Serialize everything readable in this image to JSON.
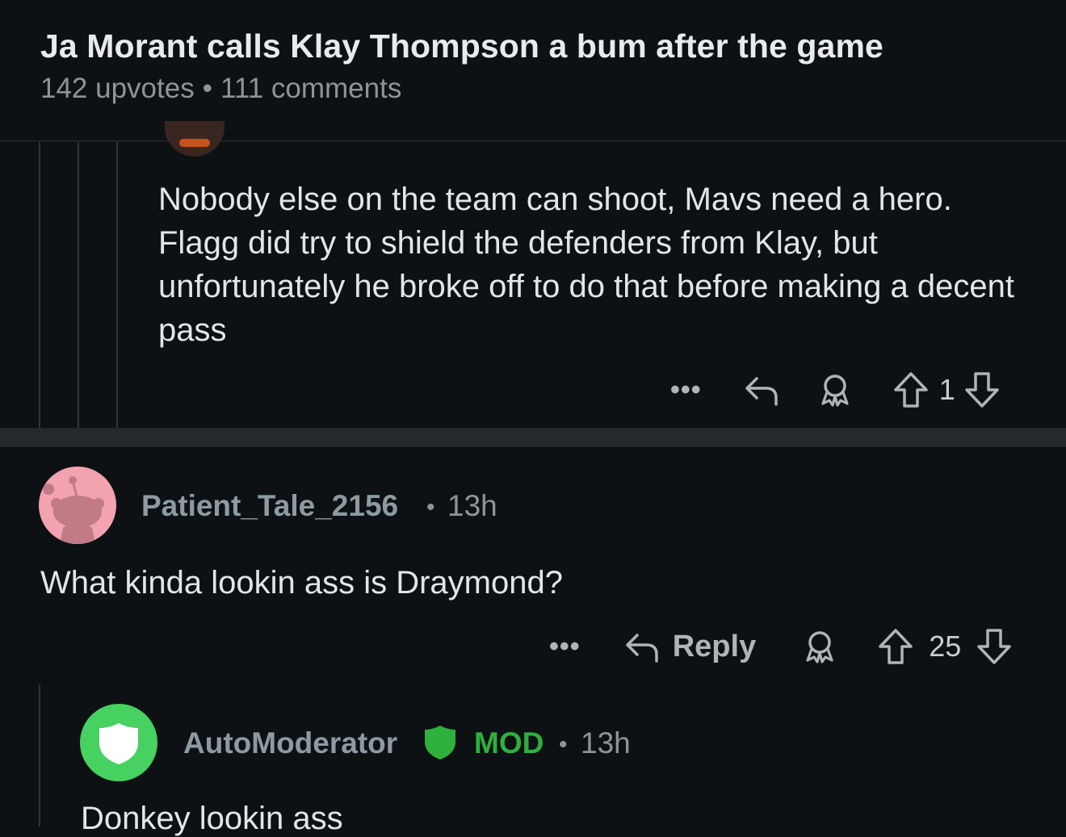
{
  "post": {
    "title": "Ja Morant calls Klay Thompson a bum after the game",
    "upvotes": "142 upvotes",
    "separator": "•",
    "comments": "111 comments"
  },
  "reply1": {
    "body": "Nobody else on the team can shoot, Mavs need a hero. Flagg did try to shield the defenders from Klay, but unfortunately he broke off to do that before making a decent pass",
    "score": "1",
    "icons": [
      "more-icon",
      "reply-icon",
      "award-icon",
      "upvote-icon",
      "downvote-icon"
    ]
  },
  "comment2": {
    "username": "Patient_Tale_2156",
    "separator": "•",
    "time": "13h",
    "body": "What kinda lookin ass is Draymond?",
    "reply_label": "Reply",
    "score": "25"
  },
  "comment3": {
    "username": "AutoModerator",
    "mod_label": "MOD",
    "separator": "•",
    "time": "13h",
    "body": "Donkey lookin ass"
  },
  "colors": {
    "background": "#0e1113",
    "text": "#e3e6e8",
    "muted": "#8e9499",
    "mod_green": "#2eb03d",
    "automod_avatar": "#46d160",
    "snoo_pink": "#f3a2b0"
  }
}
